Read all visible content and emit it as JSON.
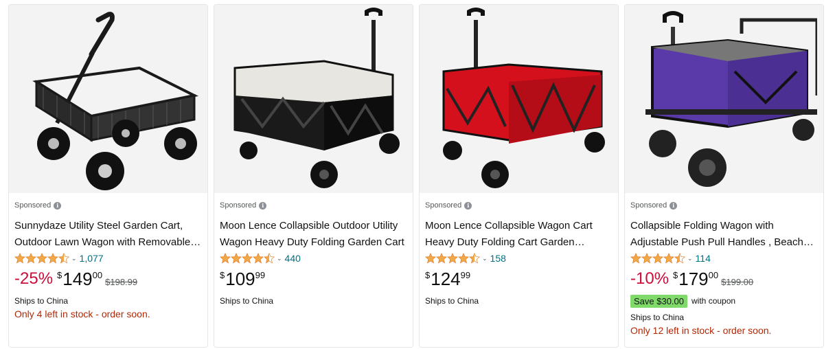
{
  "colors": {
    "discount": "#cc0c39",
    "link": "#007185",
    "stock_warning": "#b12704",
    "coupon_bg": "#7fda69",
    "star": "#f3a847",
    "card_border": "#e3e6e6",
    "image_bg": "#f3f3f3"
  },
  "products": [
    {
      "sponsored_label": "Sponsored",
      "image_icon": "garden-cart-image",
      "title": "Sunnydaze Utility Steel Garden Cart, Outdoor Lawn Wagon with Removable Sides",
      "rating_stars": 4.5,
      "review_count": "1,077",
      "discount": "-25%",
      "price_symbol": "$",
      "price_whole": "149",
      "price_fraction": "00",
      "list_price": "$198.99",
      "ships_to": "Ships to China",
      "stock_note": "Only 4 left in stock - order soon."
    },
    {
      "sponsored_label": "Sponsored",
      "image_icon": "wagon-black-image",
      "title": "Moon Lence Collapsible Outdoor Utility Wagon Heavy Duty Folding Garden Cart",
      "rating_stars": 4.5,
      "review_count": "440",
      "price_symbol": "$",
      "price_whole": "109",
      "price_fraction": "99",
      "ships_to": "Ships to China"
    },
    {
      "sponsored_label": "Sponsored",
      "image_icon": "wagon-red-image",
      "title": "Moon Lence Collapsible Wagon Cart Heavy Duty Folding Cart Garden Portable",
      "rating_stars": 4.5,
      "review_count": "158",
      "price_symbol": "$",
      "price_whole": "124",
      "price_fraction": "99",
      "ships_to": "Ships to China"
    },
    {
      "sponsored_label": "Sponsored",
      "image_icon": "wagon-purple-image",
      "title": "Collapsible Folding Wagon with Adjustable Push Pull Handles , Beach Cart",
      "rating_stars": 4.5,
      "review_count": "114",
      "discount": "-10%",
      "price_symbol": "$",
      "price_whole": "179",
      "price_fraction": "00",
      "list_price": "$199.00",
      "coupon_badge": "Save $30.00",
      "coupon_text": "with coupon",
      "ships_to": "Ships to China",
      "stock_note": "Only 12 left in stock - order soon."
    }
  ]
}
